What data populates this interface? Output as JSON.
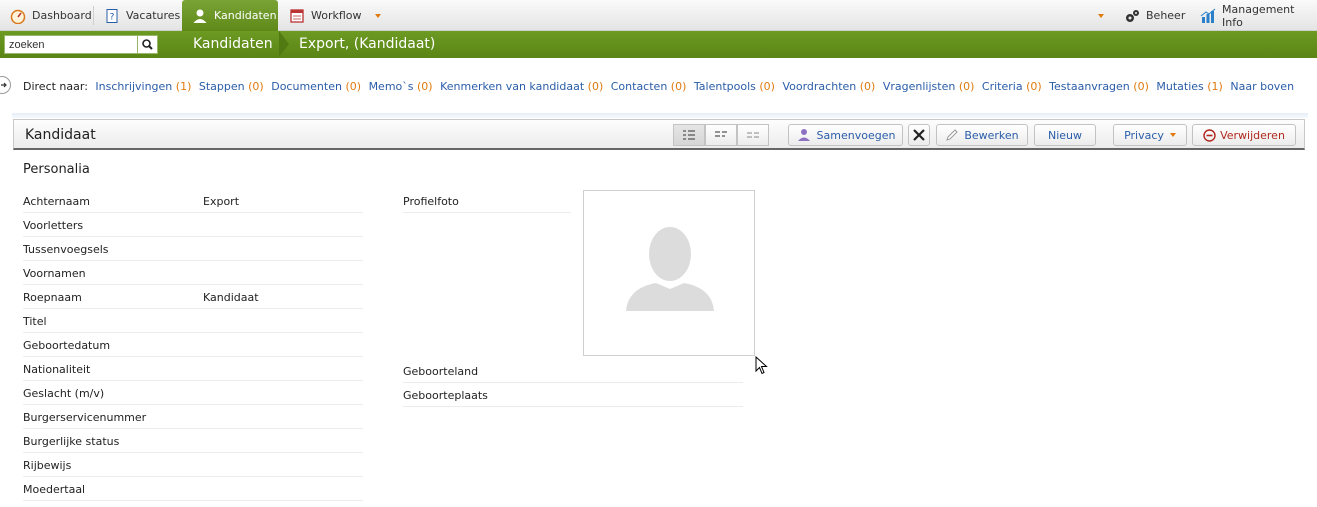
{
  "nav": {
    "tabs": [
      {
        "label": "Dashboard",
        "icon": "dashboard-icon"
      },
      {
        "label": "Vacatures",
        "icon": "vacancy-icon"
      },
      {
        "label": "Kandidaten",
        "icon": "person-icon",
        "active": true
      },
      {
        "label": "Workflow",
        "icon": "calendar-icon"
      }
    ],
    "right": [
      {
        "label": "Beheer",
        "icon": "gears-icon"
      },
      {
        "label": "Management Info",
        "icon": "chart-icon"
      }
    ]
  },
  "search": {
    "value": "zoeken"
  },
  "breadcrumb": {
    "section": "Kandidaten",
    "page": "Export, (Kandidaat)"
  },
  "direct": {
    "label": "Direct naar:",
    "links": [
      {
        "label": "Inschrijvingen",
        "count": "(1)"
      },
      {
        "label": "Stappen",
        "count": "(0)"
      },
      {
        "label": "Documenten",
        "count": "(0)"
      },
      {
        "label": "Memo`s",
        "count": "(0)"
      },
      {
        "label": "Kenmerken van kandidaat",
        "count": "(0)"
      },
      {
        "label": "Contacten",
        "count": "(0)"
      },
      {
        "label": "Talentpools",
        "count": "(0)"
      },
      {
        "label": "Voordrachten",
        "count": "(0)"
      },
      {
        "label": "Vragenlijsten",
        "count": "(0)"
      },
      {
        "label": "Criteria",
        "count": "(0)"
      },
      {
        "label": "Testaanvragen",
        "count": "(0)"
      },
      {
        "label": "Mutaties",
        "count": "(1)"
      },
      {
        "label": "Naar boven",
        "count": ""
      }
    ]
  },
  "panel": {
    "title": "Kandidaat",
    "buttons": {
      "merge": "Samenvoegen",
      "edit": "Bewerken",
      "new": "Nieuw",
      "privacy": "Privacy",
      "delete": "Verwijderen"
    }
  },
  "personalia": {
    "title": "Personalia",
    "fields": [
      {
        "label": "Achternaam",
        "value": "Export"
      },
      {
        "label": "Voorletters",
        "value": ""
      },
      {
        "label": "Tussenvoegsels",
        "value": ""
      },
      {
        "label": "Voornamen",
        "value": ""
      },
      {
        "label": "Roepnaam",
        "value": "Kandidaat"
      },
      {
        "label": "Titel",
        "value": ""
      },
      {
        "label": "Geboortedatum",
        "value": ""
      },
      {
        "label": "Nationaliteit",
        "value": ""
      },
      {
        "label": "Geslacht (m/v)",
        "value": ""
      },
      {
        "label": "Burgerservicenummer",
        "value": ""
      },
      {
        "label": "Burgerlijke status",
        "value": ""
      },
      {
        "label": "Rijbewijs",
        "value": ""
      },
      {
        "label": "Moedertaal",
        "value": ""
      }
    ],
    "right_fields": [
      {
        "label": "Profielfoto"
      },
      {
        "label": "Geboorteland"
      },
      {
        "label": "Geboorteplaats"
      }
    ]
  },
  "colors": {
    "accent_green": "#6c9a22",
    "link_blue": "#2a5da8",
    "count_orange": "#e07a10"
  }
}
